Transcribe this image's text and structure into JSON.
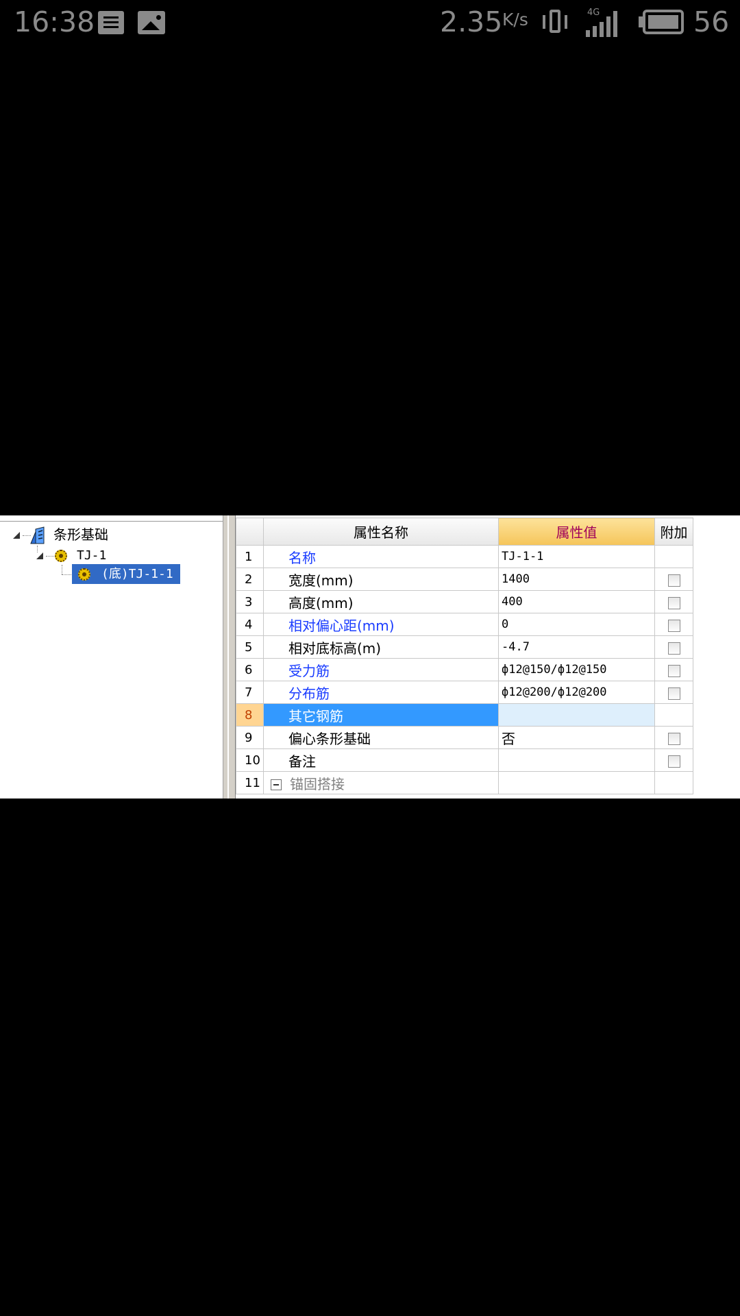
{
  "status_bar": {
    "time": "16:38",
    "speed": "2.35",
    "speed_unit": "K/s",
    "network_label": "4G",
    "battery": "56",
    "icons": [
      "document-icon",
      "image-icon",
      "vibrate-icon",
      "signal-icon",
      "battery-icon"
    ]
  },
  "tree": {
    "root": {
      "label": "条形基础",
      "icon": "strip-foundation-icon"
    },
    "child": {
      "label": "TJ-1",
      "icon": "gear-icon"
    },
    "leaf": {
      "label": "(底)TJ-1-1",
      "icon": "gear-icon",
      "selected": true
    }
  },
  "grid": {
    "headers": {
      "name": "属性名称",
      "value": "属性值",
      "extra": "附加"
    },
    "rows": [
      {
        "num": "1",
        "name": "名称",
        "value": "TJ-1-1",
        "blue": true,
        "checkbox": false
      },
      {
        "num": "2",
        "name": "宽度(mm)",
        "value": "1400",
        "blue": false,
        "checkbox": true
      },
      {
        "num": "3",
        "name": "高度(mm)",
        "value": "400",
        "blue": false,
        "checkbox": true
      },
      {
        "num": "4",
        "name": "相对偏心距(mm)",
        "value": "0",
        "blue": true,
        "checkbox": true
      },
      {
        "num": "5",
        "name": "相对底标高(m)",
        "value": "-4.7",
        "blue": false,
        "checkbox": true
      },
      {
        "num": "6",
        "name": "受力筋",
        "value": "ф12@150/ф12@150",
        "blue": true,
        "checkbox": true
      },
      {
        "num": "7",
        "name": "分布筋",
        "value": "ф12@200/ф12@200",
        "blue": true,
        "checkbox": true
      },
      {
        "num": "8",
        "name": "其它钢筋",
        "value": "",
        "blue": false,
        "checkbox": false,
        "selected": true
      },
      {
        "num": "9",
        "name": "偏心条形基础",
        "value": "否",
        "blue": false,
        "checkbox": true
      },
      {
        "num": "10",
        "name": "备注",
        "value": "",
        "blue": false,
        "checkbox": true
      },
      {
        "num": "11",
        "name": "锚固搭接",
        "value": "",
        "blue": false,
        "checkbox": false,
        "collapsible": true
      }
    ]
  },
  "colors": {
    "selection": "#316ac5",
    "row_highlight": "#3399ff",
    "blue_label": "#1a3cff",
    "header_highlight": "#f5c55a"
  }
}
